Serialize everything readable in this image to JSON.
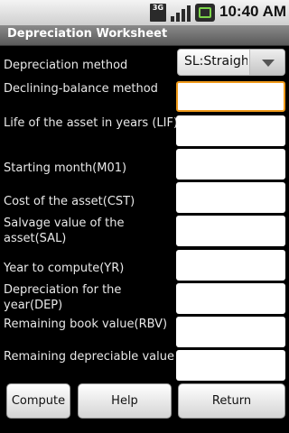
{
  "status_bar": {
    "network": "3G",
    "time": "10:40 AM"
  },
  "title_bar": {
    "title": "Depreciation Worksheet"
  },
  "form": {
    "method_label": "Depreciation method",
    "method_value": "SL:Straight Line",
    "rows": [
      {
        "label": "Declining-balance method",
        "value": ""
      },
      {
        "label": "Life of the asset in years (LIF)",
        "value": ""
      },
      {
        "label": "Starting month(M01)",
        "value": ""
      },
      {
        "label": "Cost of the asset(CST)",
        "value": ""
      },
      {
        "label_line1": "Salvage value of the",
        "label_line2": "asset(SAL)",
        "value": ""
      },
      {
        "label": "Year to compute(YR)",
        "value": ""
      },
      {
        "label_line1": "Depreciation for the",
        "label_line2": "year(DEP)",
        "value": ""
      },
      {
        "label": "Remaining book value(RBV)",
        "value": ""
      },
      {
        "label": "Remaining depreciable value",
        "value": ""
      }
    ]
  },
  "buttons": {
    "compute": "Compute",
    "help": "Help",
    "return": "Return"
  }
}
